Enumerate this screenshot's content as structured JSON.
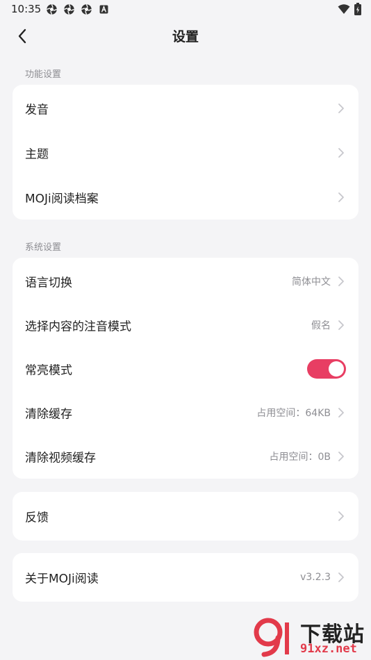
{
  "status_bar": {
    "time": "10:35"
  },
  "header": {
    "title": "设置"
  },
  "sections": {
    "function": {
      "label": "功能设置",
      "items": [
        {
          "label": "发音"
        },
        {
          "label": "主题"
        },
        {
          "label": "MOJi阅读档案"
        }
      ]
    },
    "system": {
      "label": "系统设置",
      "items": [
        {
          "label": "语言切换",
          "value": "简体中文"
        },
        {
          "label": "选择内容的注音模式",
          "value": "假名"
        },
        {
          "label": "常亮模式",
          "toggle_on": true
        },
        {
          "label": "清除缓存",
          "value": "占用空间：64KB"
        },
        {
          "label": "清除视频缓存",
          "value": "占用空间：0B"
        }
      ]
    },
    "feedback": {
      "label": "反馈"
    },
    "about": {
      "label": "关于MOJi阅读",
      "value": "v3.2.3"
    }
  },
  "watermark": {
    "title": "下载站",
    "url": "91xz.net"
  },
  "colors": {
    "accent": "#e83e63",
    "background": "#f4f4f6",
    "card": "#ffffff",
    "secondary_text": "#8e8e93"
  }
}
